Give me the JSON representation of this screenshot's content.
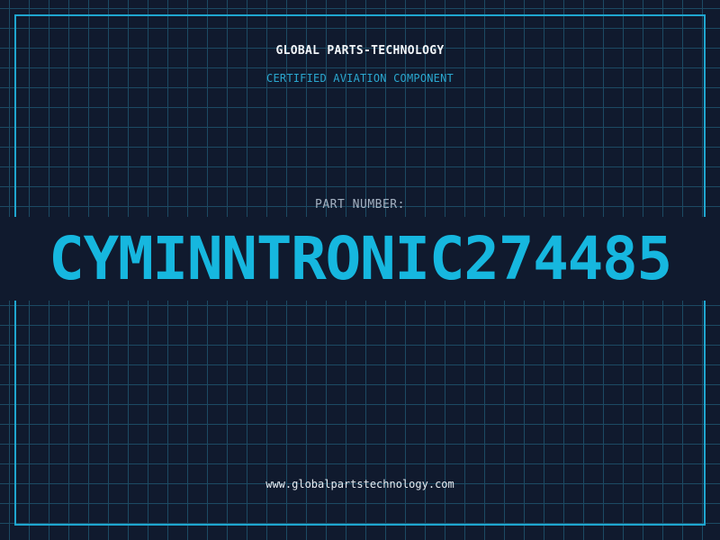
{
  "header": {
    "brand": "GLOBAL PARTS-TECHNOLOGY",
    "tagline": "CERTIFIED AVIATION COMPONENT"
  },
  "part": {
    "label": "PART NUMBER:",
    "number": "CYMINNTRONIC274485"
  },
  "footer": {
    "url": "www.globalpartstechnology.com"
  },
  "colors": {
    "background": "#101a2e",
    "grid": "#1c4a63",
    "frame": "#1fa6cf",
    "accent": "#16b7df",
    "label": "#a4b1c1",
    "text": "#f2f5f8"
  }
}
